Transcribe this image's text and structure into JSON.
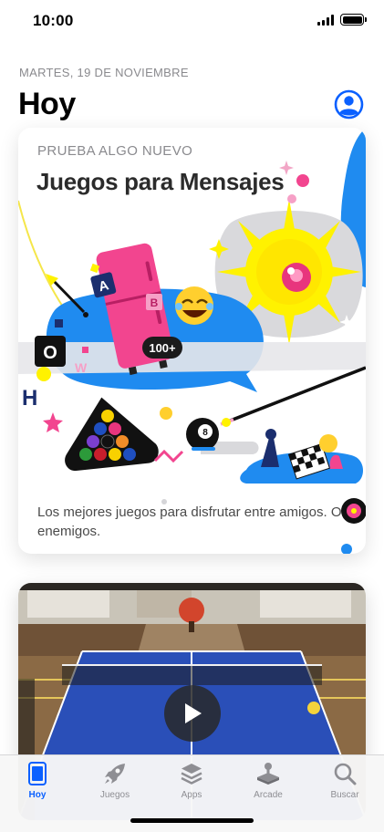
{
  "status_bar": {
    "time": "10:00",
    "signal_icon": "signal-icon",
    "battery_icon": "battery-icon"
  },
  "header": {
    "date": "MARTES, 19 DE NOVIEMBRE",
    "title": "Hoy",
    "account_icon": "account-icon"
  },
  "featured_card": {
    "eyebrow": "PRUEBA ALGO NUEVO",
    "title": "Juegos para Mensajes",
    "description": "Los mejores juegos para disfrutar entre amigos. O enemigos.",
    "badge_text": "100+",
    "ball_number": "8"
  },
  "video_card": {
    "play_icon": "play-icon"
  },
  "tab_bar": {
    "tabs": [
      {
        "label": "Hoy",
        "icon": "today-icon",
        "active": true
      },
      {
        "label": "Juegos",
        "icon": "rocket-icon",
        "active": false
      },
      {
        "label": "Apps",
        "icon": "layers-icon",
        "active": false
      },
      {
        "label": "Arcade",
        "icon": "joystick-icon",
        "active": false
      },
      {
        "label": "Buscar",
        "icon": "search-icon",
        "active": false
      }
    ]
  },
  "colors": {
    "accent": "#0a60ff",
    "tab_inactive": "#8e8e93",
    "card_blue": "#1f8bf0",
    "card_pink": "#f2458f",
    "card_yellow": "#fff200",
    "table_blue": "#1f4fc0"
  }
}
